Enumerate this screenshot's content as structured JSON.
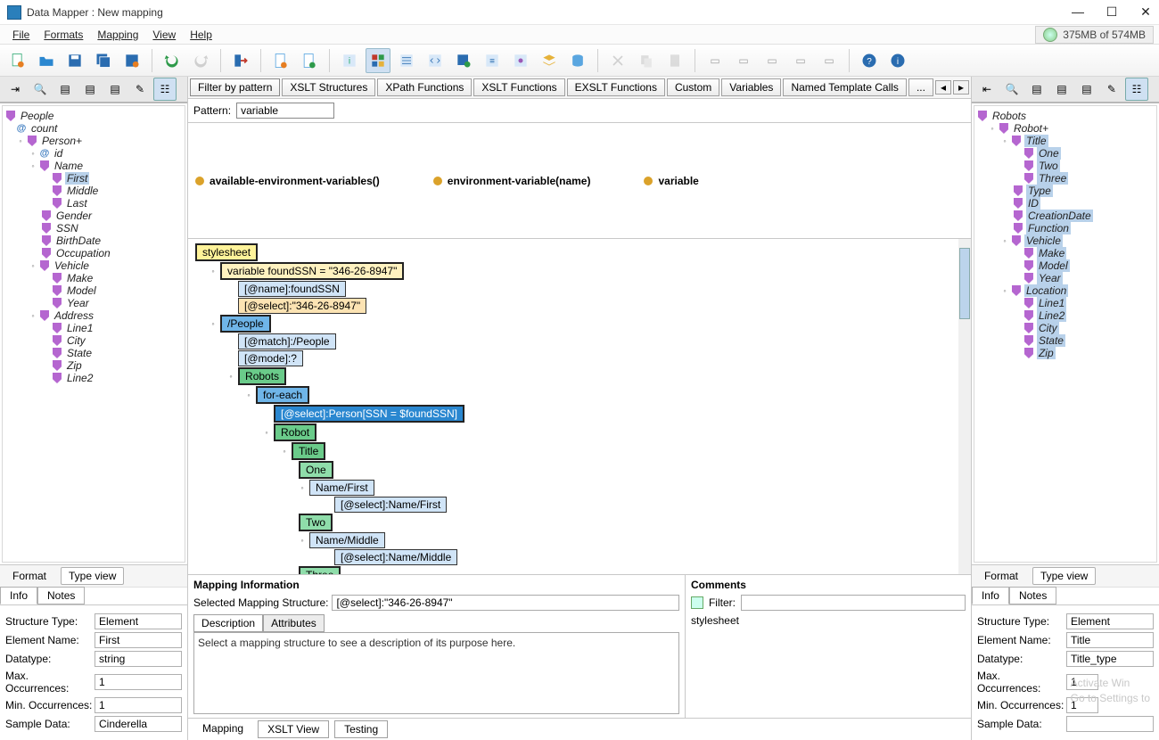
{
  "window": {
    "title": "Data Mapper : New mapping"
  },
  "menu": {
    "file": "File",
    "formats": "Formats",
    "mapping": "Mapping",
    "view": "View",
    "help": "Help"
  },
  "memory": "375MB of 574MB",
  "leftTree": {
    "root": "People",
    "count": "count",
    "person": "Person+",
    "id": "id",
    "name": "Name",
    "first": "First",
    "middle": "Middle",
    "last": "Last",
    "gender": "Gender",
    "ssn": "SSN",
    "birthdate": "BirthDate",
    "occupation": "Occupation",
    "vehicle": "Vehicle",
    "make": "Make",
    "model": "Model",
    "year": "Year",
    "address": "Address",
    "line1": "Line1",
    "city": "City",
    "state": "State",
    "zip": "Zip",
    "line2": "Line2"
  },
  "rightTree": {
    "root": "Robots",
    "robot": "Robot+",
    "title": "Title",
    "one": "One",
    "two": "Two",
    "three": "Three",
    "type": "Type",
    "id": "ID",
    "creationDate": "CreationDate",
    "function": "Function",
    "vehicle": "Vehicle",
    "make": "Make",
    "model": "Model",
    "year": "Year",
    "location": "Location",
    "line1": "Line1",
    "line2": "Line2",
    "city": "City",
    "state": "State",
    "zip": "Zip"
  },
  "filterTabs": {
    "filterByPattern": "Filter by pattern",
    "xsltStructures": "XSLT Structures",
    "xpathFunctions": "XPath Functions",
    "xsltFunctions": "XSLT Functions",
    "exsltFunctions": "EXSLT Functions",
    "custom": "Custom",
    "variables": "Variables",
    "namedTemplateCalls": "Named Template Calls",
    "more": "..."
  },
  "pattern": {
    "label": "Pattern:",
    "value": "variable"
  },
  "funcResults": {
    "a": "available-environment-variables()",
    "b": "environment-variable(name)",
    "c": "variable"
  },
  "xslt": {
    "stylesheet": "stylesheet",
    "varFound": "variable foundSSN = \"346-26-8947\"",
    "atNameFound": "[@name]:foundSSN",
    "atSelectSSN": "[@select]:\"346-26-8947\"",
    "people": "/People",
    "matchPeople": "[@match]:/People",
    "modeQ": "[@mode]:?",
    "robots": "Robots",
    "foreach": "for-each",
    "selPerson": "[@select]:Person[SSN = $foundSSN]",
    "robot": "Robot",
    "title": "Title",
    "one": "One",
    "nameFirst": "Name/First",
    "selNameFirst": "[@select]:Name/First",
    "two": "Two",
    "nameMiddle": "Name/Middle",
    "selNameMiddle": "[@select]:Name/Middle",
    "three": "Three"
  },
  "tabs": {
    "format": "Format",
    "typeView": "Type view",
    "info": "Info",
    "notes": "Notes"
  },
  "leftInfo": {
    "structureTypeL": "Structure Type:",
    "structureType": "Element",
    "elementNameL": "Element Name:",
    "elementName": "First",
    "datatypeL": "Datatype:",
    "datatype": "string",
    "maxOccL": "Max. Occurrences:",
    "maxOcc": "1",
    "minOccL": "Min. Occurrences:",
    "minOcc": "1",
    "sampleL": "Sample Data:",
    "sample": "Cinderella"
  },
  "rightInfo": {
    "structureTypeL": "Structure Type:",
    "structureType": "Element",
    "elementNameL": "Element Name:",
    "elementName": "Title",
    "datatypeL": "Datatype:",
    "datatype": "Title_type",
    "maxOccL": "Max. Occurrences:",
    "maxOcc": "1",
    "minOccL": "Min. Occurrences:",
    "minOcc": "1",
    "sampleL": "Sample Data:",
    "sample": ""
  },
  "mappingInfo": {
    "title": "Mapping Information",
    "selLabel": "Selected Mapping Structure:",
    "selValue": "[@select]:\"346-26-8947\"",
    "descTab": "Description",
    "attrTab": "Attributes",
    "descText": "Select a mapping structure to see a description of its purpose here."
  },
  "comments": {
    "title": "Comments",
    "filterLabel": "Filter:",
    "line": "stylesheet"
  },
  "bottomTabs": {
    "mapping": "Mapping",
    "xsltView": "XSLT View",
    "testing": "Testing"
  },
  "watermark": {
    "l1": "Activate Win",
    "l2": "Go to Settings to"
  }
}
